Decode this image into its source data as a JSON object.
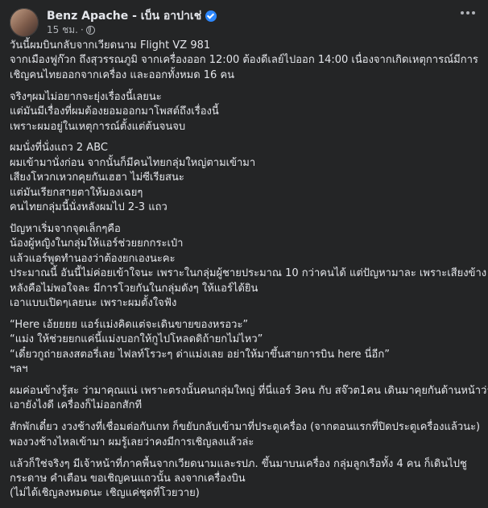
{
  "post": {
    "author": "Benz Apache - เบ็น อาปาเช่",
    "time": "15 ชม.",
    "paragraphs": [
      [
        "วันนี้ผมบินกลับจากเวียดนาม Flight VZ 981",
        "จากเมืองฟูก๊วก ถึงสุวรรณภูมิ จากเครื่องออก 12:00 ต้องดีเลย์ไปออก 14:00  เนื่องจากเกิดเหตุการณ์มีการ",
        "เชิญคนไทยออกจากเครื่อง และออกทั้งหมด 16 คน"
      ],
      [
        "จริงๆผมไม่อยากจะยุ่งเรื่องนี้เลยนะ",
        "แต่มันมีเรื่องที่ผมต้องยอมออกมาโพสต์ถึงเรื่องนี้",
        "เพราะผมอยู่ในเหตุการณ์ตั้งแต่ต้นจนจบ"
      ],
      [
        "ผมนั่งที่นั่งแถว 2 ABC",
        "ผมเข้ามานั่งก่อน จากนั้นก็มีคนไทยกลุ่มใหญ่ตามเข้ามา",
        "เสียงโหวกเหวกคุยกันเฮฮา ไม่ซีเรียสนะ",
        "แต่มันเรียกสายตาให้มองเฉยๆ",
        "คนไทยกลุ่มนี้นั่งหลังผมไป 2-3 แถว"
      ],
      [
        "ปัญหาเริ่มจากจุดเล็กๆคือ",
        "น้องผู้หญิงในกลุ่มให้แอร์ช่วยยกกระเป๋า",
        "แล้วแอร์พูดทำนองว่าต้องยกเองนะคะ",
        "ประมาณนี้ อันนี้ไม่ค่อยเข้าใจนะ เพราะในกลุ่มผู้ชายประมาณ 10 กว่าคนได้  แต่ปัญหามาละ เพราะเสียงข้าง",
        "หลังคือไม่พอใจละ มีการโวยกันในกลุ่มดังๆ ให้แอร์ได้ยิน",
        "เอาแบบเปิดๆเลยนะ  เพราะผมตั้งใจฟัง"
      ],
      [
        "“Here เอ้ยยยย แอร์แม่งคิดแต่จะเดินขายของหรอวะ”",
        "“แม่ง ให้ช่วยยกแค่นี้แม่งบอกให้กูไปโหลดดิถ้ายกไม่ไหว”",
        "“เดี๋ยวกูถ่ายลงสตอรี่เลย ไฟลท์โรวะๆ ด่าแม่งเลย อย่าให้มาขึ้นสายการบิน here นี่อีก”",
        "ฯลฯ"
      ],
      [
        "ผมค่อนข้างรู้สะ ว่ามาคุณแน่ เพราะตรงนั้นคนกลุ่มใหญ่ ที่นี่แอร์ 3คน กับ สจ๊วต1คน เดินมาคุยกันด้านหน้าว่าจะ",
        "เอายังไงดี  เครื่องก็ไม่ออกสักที"
      ],
      [
        "สักพักเดี๋ยว งวงช้างที่เชื่อมต่อกับเกท  ก็ขยับกลับเข้ามาที่ประตูเครื่อง (จากตอนแรกที่ปิดประตูเครื่องแล้วนะ)",
        "พองวงช้างไหลเข้ามา ผมรู้เลยว่าคงมีการเชิญลงแล้วล่ะ"
      ],
      [
        "แล้วก็ใช่จริงๆ มีเจ้าหน้าที่ภาคพื้นจากเวียดนามและรปภ. ขึ้นมาบนเครื่อง กลุ่มลูกเรือทั้ง 4 คน ก็เดินไปชู",
        "กระดาษ คำเตือน ขอเชิญคนแถวนั้น ลงจากเครื่องบิน",
        "(ไม่ได้เชิญลงหมดนะ เชิญแค่ชุดที่โวยวาย)"
      ]
    ]
  }
}
